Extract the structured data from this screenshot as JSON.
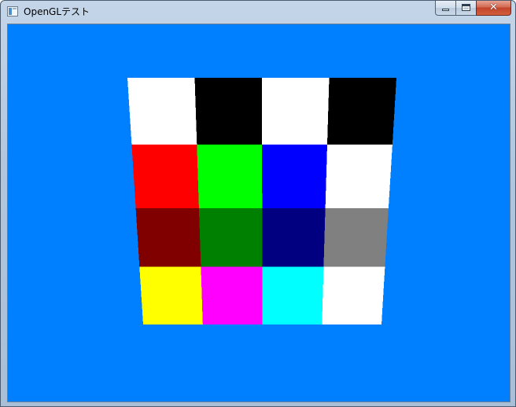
{
  "window": {
    "title": "OpenGLテスト",
    "icon": "window-app-icon",
    "buttons": {
      "minimize": "minimize-icon",
      "maximize": "maximize-icon",
      "close": "close-icon",
      "close_glyph": "✕"
    }
  },
  "viewport": {
    "background_color": "#0080ff",
    "grid": {
      "rows": 4,
      "columns": 4,
      "cells": [
        [
          "#ffffff",
          "#000000",
          "#ffffff",
          "#000000"
        ],
        [
          "#ff0000",
          "#00ff00",
          "#0000ff",
          "#ffffff"
        ],
        [
          "#800000",
          "#008000",
          "#000080",
          "#808080"
        ],
        [
          "#ffff00",
          "#ff00ff",
          "#00ffff",
          "#ffffff"
        ]
      ]
    }
  }
}
